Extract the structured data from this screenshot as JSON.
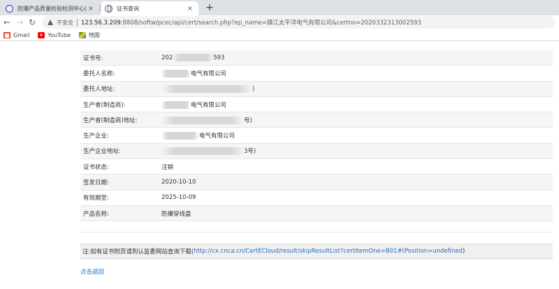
{
  "browser": {
    "tabs": [
      {
        "title": "防爆产品质量检验检测中心(天津",
        "close": "×"
      },
      {
        "title": "证书查询",
        "close": "×"
      }
    ],
    "new_tab": "+",
    "nav": {
      "back": "←",
      "forward": "→",
      "reload": "↻"
    },
    "security_label": "不安全",
    "url_host": "123.56.3.209",
    "url_rest": ":8808/softw/pcec/api/cert/search.php?ep_name=镇江太平洋电气有限公司&certno=2020332313002593",
    "bookmarks": [
      {
        "label": "Gmail",
        "icon": "gmail-icon"
      },
      {
        "label": "YouTube",
        "icon": "youtube-icon"
      },
      {
        "label": "地图",
        "icon": "maps-icon"
      }
    ]
  },
  "certificate": {
    "rows": [
      {
        "label": "证书号:",
        "prefix": "202",
        "suffix": "593"
      },
      {
        "label": "委托人名称:",
        "prefix": "",
        "suffix": "电气有限公司"
      },
      {
        "label": "委托人地址:",
        "prefix": "",
        "suffix": ")"
      },
      {
        "label": "生产者(制造商):",
        "prefix": "",
        "suffix": "电气有限公司"
      },
      {
        "label": "生产者(制造商)地址:",
        "prefix": "",
        "suffix": "号)"
      },
      {
        "label": "生产企业:",
        "prefix": "",
        "suffix": "电气有限公司"
      },
      {
        "label": "生产企业地址:",
        "prefix": "",
        "suffix": "3号)"
      },
      {
        "label": "证书状态:",
        "prefix": "注销",
        "suffix": ""
      },
      {
        "label": "签发日期:",
        "prefix": "2020-10-10",
        "suffix": ""
      },
      {
        "label": "有效期至:",
        "prefix": "2025-10-09",
        "suffix": ""
      },
      {
        "label": "产品名称:",
        "prefix": "防爆穿线盒",
        "suffix": ""
      }
    ]
  },
  "note": {
    "text": "注:如有证书附页请到认监委网站查询下载(",
    "link": "http://cx.cnca.cn/CertECloud/result/skipResultList?certItemOne=B01#tPosition=undefined",
    "close_paren": ")"
  },
  "back_link": "点击返回"
}
